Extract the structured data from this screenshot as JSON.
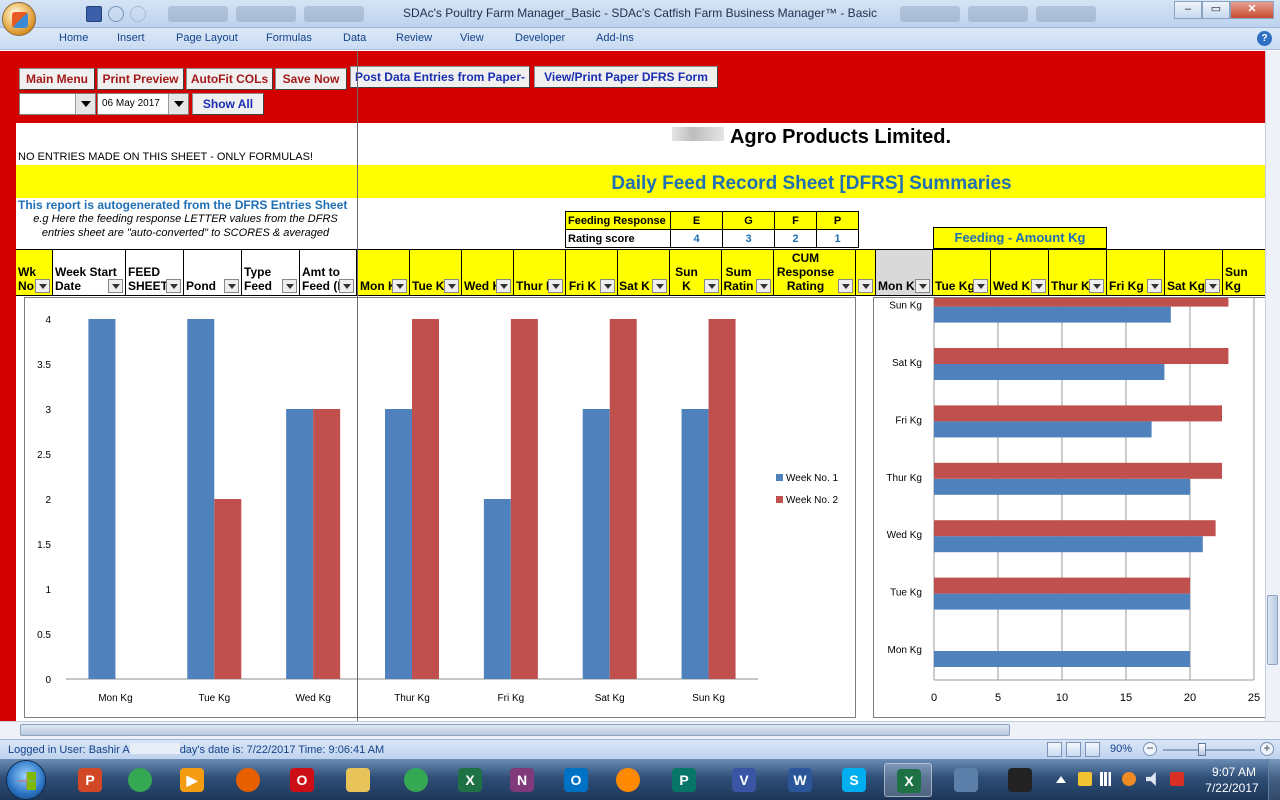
{
  "window": {
    "title": "SDAc's Poultry Farm Manager_Basic - SDAc's Catfish Farm Business Manager™ - Basic",
    "controls": [
      "–",
      "▭",
      "✕"
    ]
  },
  "ribbon": {
    "tabs": [
      "Home",
      "Insert",
      "Page Layout",
      "Formulas",
      "Data",
      "Review",
      "View",
      "Developer",
      "Add-Ins"
    ]
  },
  "toolbar": {
    "main_menu": "Main Menu",
    "print_preview": "Print Preview",
    "autofit": "AutoFit COLs",
    "save_now": "Save Now",
    "post_entries": "Post Data Entries from Paper-",
    "view_print": "View/Print Paper DFRS Form",
    "filter_value": "",
    "date_value": "06 May 2017",
    "show_all": "Show All"
  },
  "sheet": {
    "company": "Agro Products Limited.",
    "no_entries": "NO ENTRIES MADE ON THIS SHEET - ONLY FORMULAS!",
    "report_title": "Daily Feed Record Sheet [DFRS] Summaries",
    "autogen": "This report is autogenerated from the DFRS Entries Sheet",
    "eg_note": "e.g Here the feeding response LETTER values from the DFRS entries sheet are \"auto-converted\" to SCORES & averaged",
    "response_table": {
      "row1_label": "Feeding Response",
      "row2_label": "Rating score",
      "letters": [
        "E",
        "G",
        "F",
        "P"
      ],
      "scores": [
        "4",
        "3",
        "2",
        "1"
      ]
    },
    "feeding_amount_title": "Feeding - Amount Kg",
    "headers": {
      "wk_no": "Wk\nNo",
      "week_start": "Week Start\nDate",
      "feed_sheet": "FEED\nSHEET",
      "pond": "Pond",
      "type_feed": "Type\nFeed",
      "amt_feed": "Amt to\nFeed (K",
      "mon": "Mon K",
      "tue": "Tue K",
      "wed": "Wed K",
      "thur": "Thur K",
      "fri": "Fri K",
      "sat": "Sat K",
      "sun": "Sun K",
      "sum_rating": "Sum\nRatin",
      "cum_rating": "Week's CUM\nResponse\nRating",
      "mon_kg": "Mon K",
      "tue_kg": "Tue Kg",
      "wed_kg": "Wed K",
      "thur_kg": "Thur K",
      "fri_kg": "Fri Kg",
      "sat_kg": "Sat Kg",
      "sun_kg": "Sun Kg"
    }
  },
  "chart_data": [
    {
      "type": "bar",
      "categories": [
        "Mon Kg",
        "Tue Kg",
        "Wed Kg",
        "Thur Kg",
        "Fri Kg",
        "Sat Kg",
        "Sun Kg"
      ],
      "series": [
        {
          "name": "Week No. 1",
          "values": [
            4,
            4,
            3,
            3,
            2,
            3,
            3
          ],
          "color": "#4f81bd"
        },
        {
          "name": "Week No. 2",
          "values": [
            0,
            2,
            3,
            4,
            4,
            4,
            4
          ],
          "color": "#c0504d"
        }
      ],
      "yticks": [
        "0",
        "0.5",
        "1",
        "1.5",
        "2",
        "2.5",
        "3",
        "3.5",
        "4"
      ],
      "ylim": [
        0,
        4
      ],
      "legend": "right",
      "grid": false
    },
    {
      "type": "bar",
      "orientation": "horizontal",
      "categories": [
        "Mon Kg",
        "Tue Kg",
        "Wed Kg",
        "Thur Kg",
        "Fri Kg",
        "Sat Kg",
        "Sun Kg"
      ],
      "series": [
        {
          "name": "Week No. 1",
          "values": [
            20,
            20,
            21,
            20,
            17,
            18,
            18.5
          ],
          "color": "#4f81bd"
        },
        {
          "name": "Week No. 2",
          "values": [
            0,
            20,
            22,
            22.5,
            22.5,
            23,
            23
          ],
          "color": "#c0504d"
        }
      ],
      "xticks": [
        "0",
        "5",
        "10",
        "15",
        "20",
        "25"
      ],
      "xlim": [
        0,
        25
      ],
      "grid": true
    }
  ],
  "status": {
    "user_prefix": "Logged in User: Bashir A",
    "user_suffix": "day's date is: 7/22/2017 Time: 9:06:41 AM",
    "zoom": "90%"
  },
  "taskbar": {
    "apps": [
      {
        "name": "powerpoint",
        "glyph": "P",
        "color": "#d24726"
      },
      {
        "name": "chrome",
        "glyph": "",
        "color": "#34a853"
      },
      {
        "name": "media-player",
        "glyph": "▶",
        "color": "#f39c12"
      },
      {
        "name": "firefox",
        "glyph": "",
        "color": "#e66000"
      },
      {
        "name": "opera",
        "glyph": "O",
        "color": "#cc0f16"
      },
      {
        "name": "explorer",
        "glyph": "",
        "color": "#e8c35a"
      },
      {
        "name": "chrome-2",
        "glyph": "",
        "color": "#34a853"
      },
      {
        "name": "excel",
        "glyph": "X",
        "color": "#1e7145"
      },
      {
        "name": "onenote",
        "glyph": "N",
        "color": "#80397b"
      },
      {
        "name": "outlook",
        "glyph": "O",
        "color": "#0072c6"
      },
      {
        "name": "uc-browser",
        "glyph": "",
        "color": "#ff8a00"
      },
      {
        "name": "publisher",
        "glyph": "P",
        "color": "#077568"
      },
      {
        "name": "visio",
        "glyph": "V",
        "color": "#3955a3"
      },
      {
        "name": "word",
        "glyph": "W",
        "color": "#2b579a"
      },
      {
        "name": "skype",
        "glyph": "S",
        "color": "#00aff0"
      },
      {
        "name": "excel-active",
        "glyph": "X",
        "color": "#1e7145"
      },
      {
        "name": "app-tool",
        "glyph": "",
        "color": "#5b7fa8"
      },
      {
        "name": "blackberry",
        "glyph": "",
        "color": "#222222"
      }
    ],
    "time": "9:07 AM",
    "date": "7/22/2017"
  }
}
